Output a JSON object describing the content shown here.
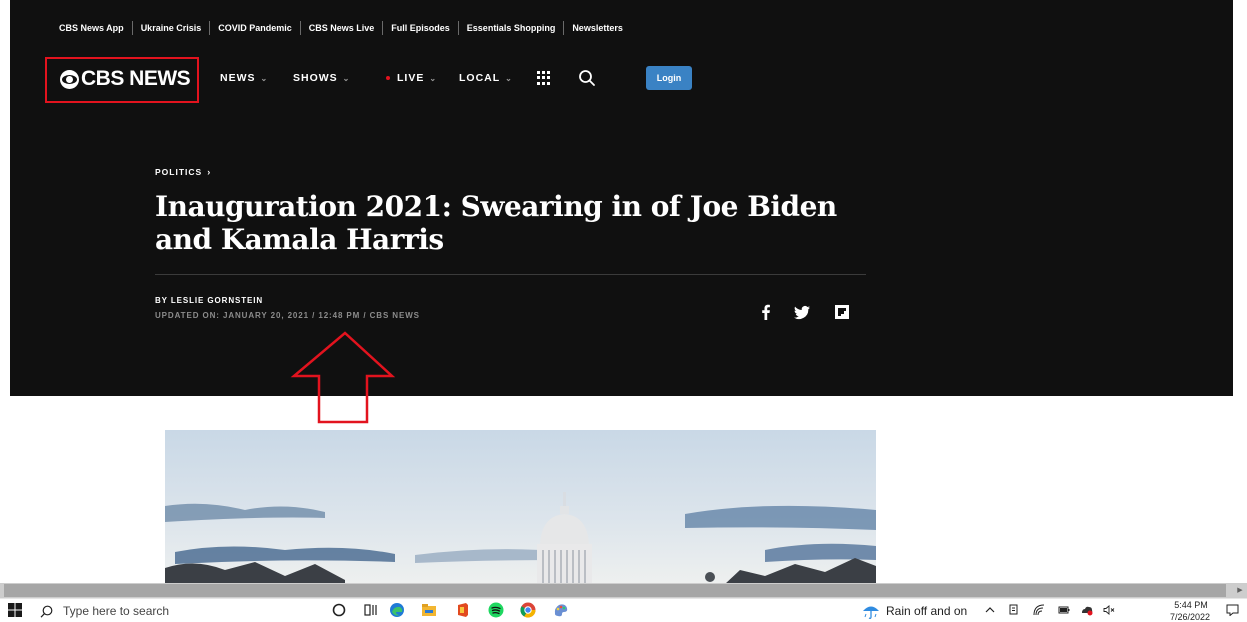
{
  "trending": [
    "CBS News App",
    "Ukraine Crisis",
    "COVID Pandemic",
    "CBS News Live",
    "Full Episodes",
    "Essentials Shopping",
    "Newsletters"
  ],
  "logo": "CBS NEWS",
  "nav": {
    "news": "NEWS",
    "shows": "SHOWS",
    "live": "LIVE",
    "local": "LOCAL",
    "login": "Login"
  },
  "article": {
    "section": "POLITICS",
    "headline": "Inauguration 2021: Swearing in of Joe Biden and Kamala Harris",
    "byline": "BY LESLIE GORNSTEIN",
    "dateline": "UPDATED ON: JANUARY 20, 2021 / 12:48 PM / CBS NEWS"
  },
  "share_icons": [
    "facebook-icon",
    "twitter-icon",
    "flipboard-icon"
  ],
  "taskbar": {
    "search_placeholder": "Type here to search",
    "weather": "Rain off and on",
    "time": "5:44 PM",
    "date": "7/26/2022",
    "apps": [
      "cortana-icon",
      "task-view-icon",
      "edge-icon",
      "file-explorer-icon",
      "office-icon",
      "spotify-icon",
      "chrome-icon",
      "paint-icon"
    ]
  },
  "colors": {
    "site_bg": "#101010",
    "annotation_red": "#e2131e",
    "login_blue": "#3a82c4",
    "live_red": "#e2131e"
  }
}
